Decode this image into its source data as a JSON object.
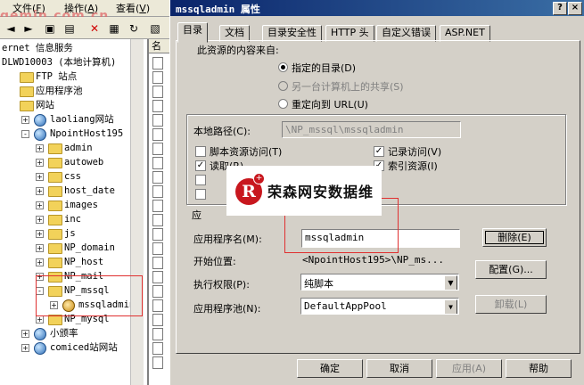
{
  "mmc": {
    "watermark": "gemin.com.cn",
    "menu": [
      {
        "label": "文件",
        "key": "F"
      },
      {
        "label": "操作",
        "key": "A"
      },
      {
        "label": "查看",
        "key": "V"
      }
    ],
    "tree": [
      {
        "label": "ernet 信息服务",
        "indent": 0,
        "icon": "none",
        "expander": ""
      },
      {
        "label": "DLWD10003 (本地计算机)",
        "indent": 0,
        "icon": "none",
        "expander": ""
      },
      {
        "label": "FTP 站点",
        "indent": 1,
        "icon": "folder",
        "expander": ""
      },
      {
        "label": "应用程序池",
        "indent": 1,
        "icon": "folder",
        "expander": ""
      },
      {
        "label": "网站",
        "indent": 1,
        "icon": "folder",
        "expander": ""
      },
      {
        "label": "laoliang网站",
        "indent": 2,
        "icon": "globe",
        "expander": "+"
      },
      {
        "label": "NpointHost195",
        "indent": 2,
        "icon": "globe",
        "expander": "-"
      },
      {
        "label": "admin",
        "indent": 3,
        "icon": "folder",
        "expander": "+"
      },
      {
        "label": "autoweb",
        "indent": 3,
        "icon": "folder",
        "expander": "+"
      },
      {
        "label": "css",
        "indent": 3,
        "icon": "folder",
        "expander": "+"
      },
      {
        "label": "host_date",
        "indent": 3,
        "icon": "folder",
        "expander": "+"
      },
      {
        "label": "images",
        "indent": 3,
        "icon": "folder",
        "expander": "+"
      },
      {
        "label": "inc",
        "indent": 3,
        "icon": "folder",
        "expander": "+"
      },
      {
        "label": "js",
        "indent": 3,
        "icon": "folder",
        "expander": "+"
      },
      {
        "label": "NP_domain",
        "indent": 3,
        "icon": "folder",
        "expander": "+"
      },
      {
        "label": "NP_host",
        "indent": 3,
        "icon": "folder",
        "expander": "+"
      },
      {
        "label": "NP_mail",
        "indent": 3,
        "icon": "folder",
        "expander": "+"
      },
      {
        "label": "NP_mssql",
        "indent": 3,
        "icon": "folder",
        "expander": "-"
      },
      {
        "label": "mssqladmin",
        "indent": 4,
        "icon": "gear",
        "expander": "+"
      },
      {
        "label": "NP_mysql",
        "indent": 3,
        "icon": "folder",
        "expander": "+"
      },
      {
        "label": "小颁率",
        "indent": 2,
        "icon": "globe",
        "expander": "+"
      },
      {
        "label": "comiced站网站",
        "indent": 2,
        "icon": "globe",
        "expander": "+"
      }
    ],
    "list_header": "名"
  },
  "dialog": {
    "title": "mssqladmin 属性",
    "title_buttons": [
      "?",
      "×"
    ],
    "tabs": [
      "目录",
      "文档",
      "目录安全性",
      "HTTP 头",
      "自定义错误",
      "ASP.NET"
    ],
    "active_tab": 0,
    "content_source_label": "此资源的内容来自:",
    "sources": [
      {
        "label": "指定的目录(D)",
        "selected": true,
        "disabled": false
      },
      {
        "label": "另一台计算机上的共享(S)",
        "selected": false,
        "disabled": true
      },
      {
        "label": "重定向到 URL(U)",
        "selected": false,
        "disabled": false
      }
    ],
    "local_path_label": "本地路径(C):",
    "local_path_value": "\\NP_mssql\\mssqladmin",
    "checkboxes_left": [
      {
        "label": "脚本资源访问(T)",
        "checked": false
      },
      {
        "label": "读取(R)",
        "checked": true
      },
      {
        "label": "",
        "checked": false
      },
      {
        "label": "",
        "checked": false
      }
    ],
    "checkboxes_right": [
      {
        "label": "记录访问(V)",
        "checked": true
      },
      {
        "label": "索引资源(I)",
        "checked": true
      }
    ],
    "app_settings_label": "应",
    "app_name_label": "应用程序名(M):",
    "app_name_value": "mssqladmin",
    "remove_button": "删除(E)",
    "start_point_label": "开始位置:",
    "start_point_value": "<NpointHost195>\\NP_ms...",
    "config_button": "配置(G)...",
    "exec_perm_label": "执行权限(P):",
    "exec_perm_value": "纯脚本",
    "app_pool_label": "应用程序池(N):",
    "app_pool_value": "DefaultAppPool",
    "unload_button": "卸载(L)",
    "ok_button": "确定",
    "cancel_button": "取消",
    "apply_button": "应用(A)",
    "help_button": "帮助"
  },
  "overlay_logo": {
    "mark": "R",
    "text": "荣森网安数据维"
  }
}
